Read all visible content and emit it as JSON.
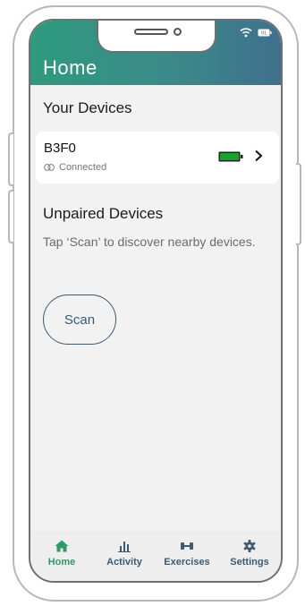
{
  "header": {
    "title": "Home"
  },
  "status_bar": {
    "battery_level": "91",
    "wifi_icon": "wifi-icon"
  },
  "sections": {
    "your_devices": "Your Devices",
    "unpaired_devices": "Unpaired Devices"
  },
  "devices": [
    {
      "name": "B3F0",
      "status": "Connected",
      "battery": "full"
    }
  ],
  "scan": {
    "hint": "Tap ‘Scan’ to discover nearby devices.",
    "button_label": "Scan"
  },
  "tabs": [
    {
      "label": "Home",
      "icon": "home-icon",
      "active": true
    },
    {
      "label": "Activity",
      "icon": "bar-chart-icon",
      "active": false
    },
    {
      "label": "Exercises",
      "icon": "dumbbell-icon",
      "active": false
    },
    {
      "label": "Settings",
      "icon": "gear-icon",
      "active": false
    }
  ],
  "colors": {
    "header_start": "#2e9a7d",
    "header_end": "#3f708c",
    "accent_active": "#2e9a6a",
    "accent_inactive": "#3c5a72",
    "battery_green": "#17a32b"
  }
}
